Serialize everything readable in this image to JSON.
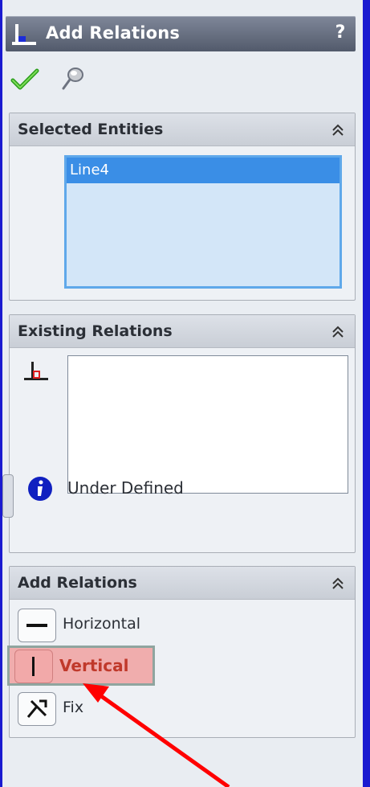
{
  "titlebar": {
    "title": "Add Relations",
    "help": "?"
  },
  "toolbar": {
    "ok_icon": "checkmark-icon",
    "pin_icon": "pushpin-icon"
  },
  "selected_entities": {
    "title": "Selected Entities",
    "items": [
      "Line4"
    ]
  },
  "existing_relations": {
    "title": "Existing Relations",
    "items": [],
    "status": "Under Defined"
  },
  "add_relations": {
    "title": "Add Relations",
    "items": [
      {
        "label": "Horizontal",
        "icon": "horizontal-icon",
        "highlighted": false
      },
      {
        "label": "Vertical",
        "icon": "vertical-icon",
        "highlighted": true
      },
      {
        "label": "Fix",
        "icon": "fix-icon",
        "highlighted": false
      }
    ]
  },
  "colors": {
    "background": "#1a1ad0",
    "highlight": "#f0adad",
    "arrow": "#ff0000",
    "selection": "#3a8ee6"
  }
}
